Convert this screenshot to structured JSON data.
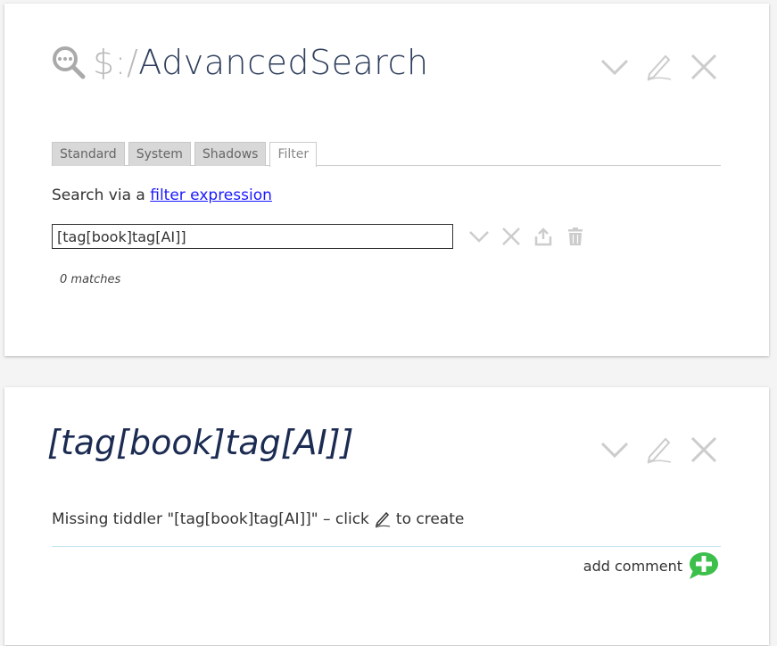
{
  "tiddler1": {
    "title_prefix": "$:/",
    "title": "AdvancedSearch",
    "tabs": [
      "Standard",
      "System",
      "Shadows",
      "Filter"
    ],
    "active_tab": "Filter",
    "search_via_text": "Search via a ",
    "search_via_link": "filter expression",
    "filter_value": "[tag[book]tag[AI]]",
    "matches_text": "0 matches",
    "icons": [
      "search-icon",
      "chevron-down-icon",
      "pencil-icon",
      "close-icon",
      "export-icon",
      "trash-icon"
    ]
  },
  "tiddler2": {
    "title": "[tag[book]tag[AI]]",
    "missing_before": "Missing tiddler \"[tag[book]tag[AI]]\" – click",
    "missing_after": "to create",
    "add_comment": "add comment",
    "accent_color": "#3dbf4b"
  }
}
